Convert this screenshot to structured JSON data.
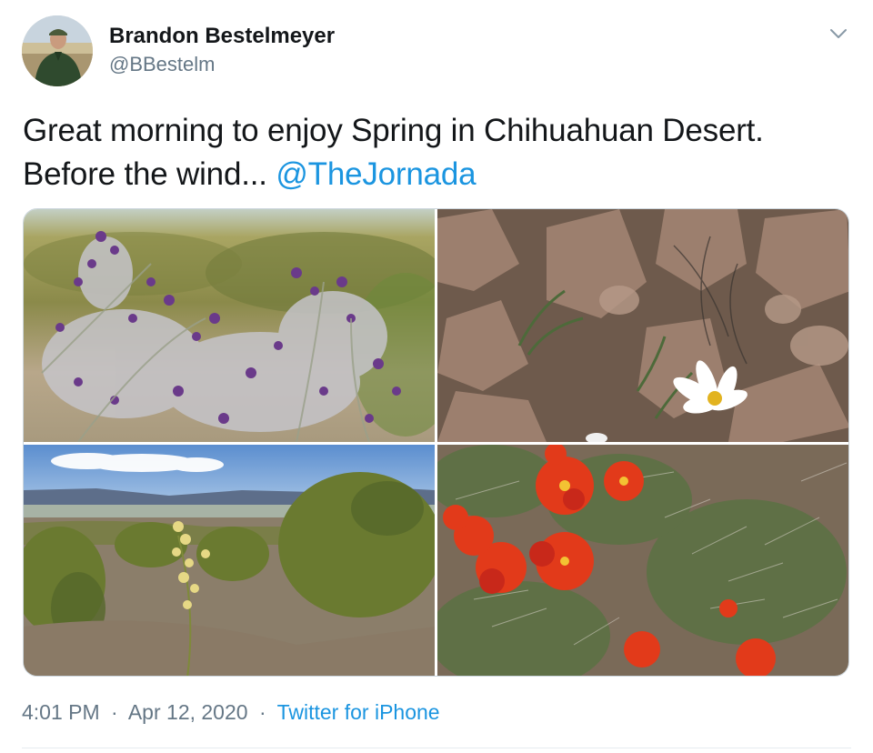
{
  "user": {
    "display_name": "Brandon Bestelmeyer",
    "handle": "@BBestelm",
    "avatar_icon": "user-avatar"
  },
  "tweet": {
    "text": "Great morning to enjoy Spring in Chihuahuan Desert. Before the wind... ",
    "mention": "@TheJornada"
  },
  "media": {
    "photos": [
      {
        "name": "purple-wildflowers-photo"
      },
      {
        "name": "rocks-white-daisy-photo"
      },
      {
        "name": "desert-landscape-photo"
      },
      {
        "name": "red-cactus-flowers-photo"
      }
    ]
  },
  "meta": {
    "time": "4:01 PM",
    "date": "Apr 12, 2020",
    "separator": "·",
    "source": "Twitter for iPhone"
  },
  "colors": {
    "link": "#1b95e0",
    "secondary_text": "#657786",
    "primary_text": "#14171a",
    "border": "#ccd6dd"
  },
  "icons": {
    "menu": "chevron-down-icon"
  }
}
